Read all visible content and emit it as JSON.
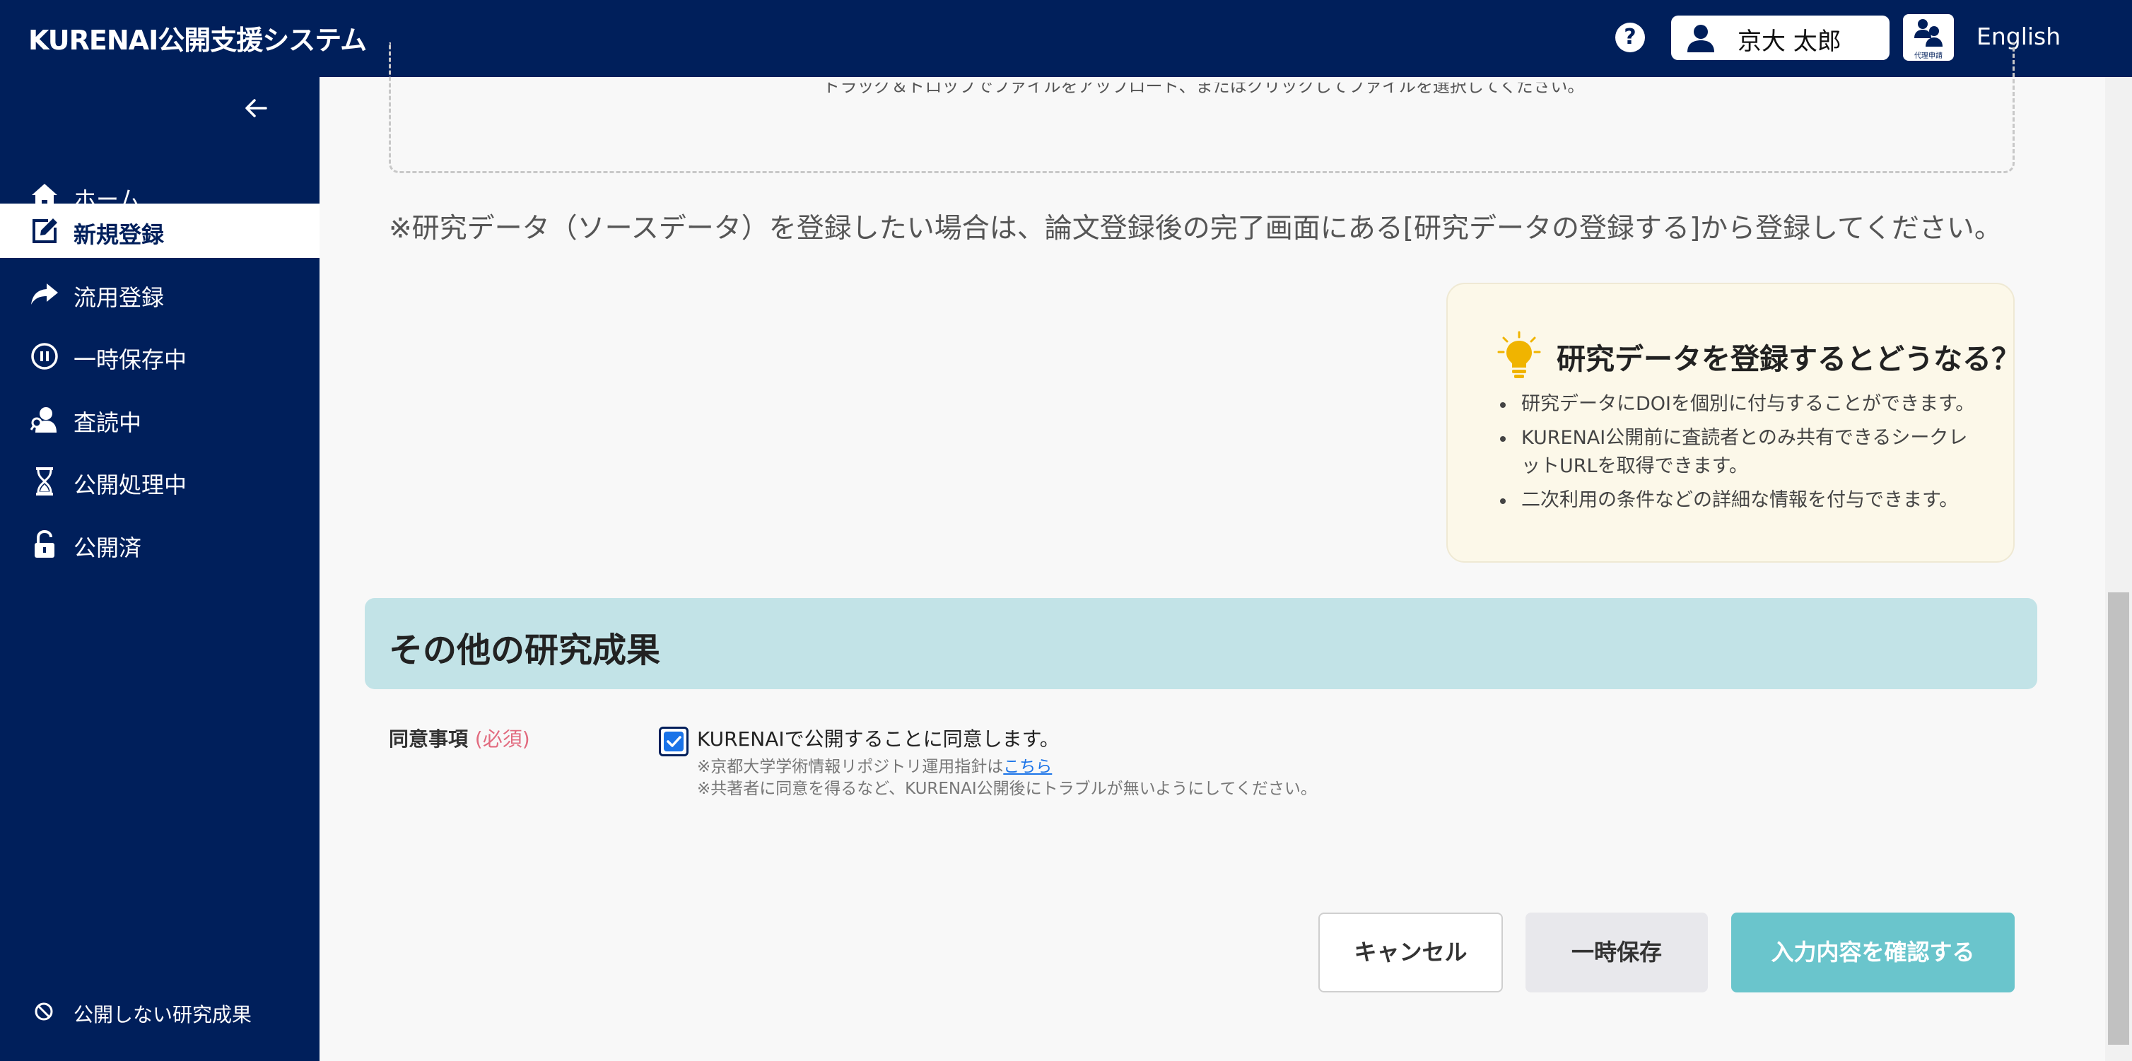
{
  "header": {
    "brand": "KURENAI公開支援システム",
    "help_icon_text": "?",
    "user_name": "京大 太郎",
    "proxy_label": "代理申請",
    "language": "English"
  },
  "sidebar": {
    "items": [
      {
        "label": "ホーム",
        "icon": "home-icon"
      },
      {
        "label": "新規登録",
        "icon": "edit-icon",
        "active": true
      },
      {
        "label": "流用登録",
        "icon": "share-arrow-icon"
      },
      {
        "label": "一時保存中",
        "icon": "pause-icon"
      },
      {
        "label": "査読中",
        "icon": "reviewer-icon"
      },
      {
        "label": "公開処理中",
        "icon": "hourglass-icon"
      },
      {
        "label": "公開済",
        "icon": "unlock-icon"
      }
    ],
    "footer_item": {
      "label": "公開しない研究成果",
      "icon": "ban-icon"
    }
  },
  "main": {
    "dropzone_text": "ドラッグ＆ドロップでファイルをアップロード、またはクリックしてファイルを選択してください。",
    "note": "※研究データ（ソースデータ）を登録したい場合は、論文登録後の完了画面にある[研究データの登録する]から登録してください。",
    "tip": {
      "title": "研究データを登録するとどうなる？",
      "items": [
        "研究データにDOIを個別に付与することができます。",
        "KURENAI公開前に査読者とのみ共有できるシークレットURLを取得できます。",
        "二次利用の条件などの詳細な情報を付与できます。"
      ]
    },
    "section_title": "その他の研究成果",
    "consent": {
      "label": "同意事項",
      "required": "(必須)",
      "checked": true,
      "text": "KURENAIで公開することに同意します。",
      "sub1_prefix": "※京都大学学術情報リポジトリ運用指針は",
      "sub1_link": "こちら",
      "sub2": "※共著者に同意を得るなど、KURENAI公開後にトラブルが無いようにしてください。"
    },
    "buttons": {
      "cancel": "キャンセル",
      "temp_save": "一時保存",
      "confirm": "入力内容を確認する"
    }
  },
  "colors": {
    "navy": "#001f5b",
    "section_bg": "#c2e3e7",
    "tip_bg": "#fcf8e9",
    "confirm_btn": "#6ac5cc",
    "required": "#e26b7f"
  }
}
